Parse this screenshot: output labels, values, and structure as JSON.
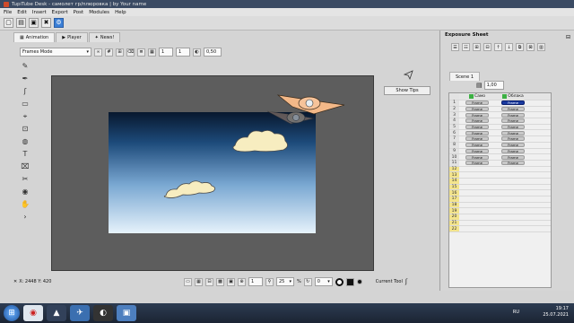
{
  "window": {
    "title": "TupiTube Desk - самолет гр/плюровка | by Your name"
  },
  "menu": [
    "File",
    "Edit",
    "Insert",
    "Export",
    "Post",
    "Modules",
    "Help"
  ],
  "tabs": [
    {
      "label": "Animation",
      "icon": "film-icon"
    },
    {
      "label": "Player",
      "icon": "play-icon"
    },
    {
      "label": "News!",
      "icon": "bird-icon"
    }
  ],
  "mode_select": "Frames Mode",
  "toolbar_values": {
    "frame_a": "1",
    "frame_b": "1",
    "opacity": "0,50"
  },
  "show_tips": "Show Tips",
  "status": {
    "coords": "X: 2448 Y: 420",
    "zoom": "25",
    "zoom_unit": "%",
    "rotation": "0",
    "current_tool": "Current Tool"
  },
  "exposure": {
    "title": "Exposure Sheet",
    "scene_tab": "Scene 1",
    "fps": "1,00",
    "layers": [
      "Само",
      "Облака"
    ],
    "frame_label": "Frame",
    "rows": 22,
    "filled_rows": 11,
    "selected": {
      "row": 1,
      "layer": 1
    }
  },
  "clock": {
    "time": "19:17",
    "date": "25.07.2021",
    "lang": "RU"
  },
  "colors": {
    "sky_top": "#08182e",
    "sky_bottom": "#e6f2fb",
    "cloud": "#f7edc0",
    "accent": "#3b7fd6"
  }
}
